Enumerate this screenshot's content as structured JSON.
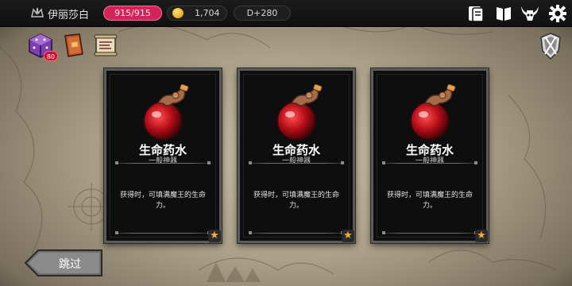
{
  "header": {
    "player_name": "伊丽莎白",
    "hp": "915/915",
    "gold": "1,704",
    "day": "D+280",
    "icons": [
      "crown-icon",
      "coin-icon",
      "quest-card-icon",
      "codex-book-icon",
      "demon-lord-icon",
      "settings-gear-icon"
    ]
  },
  "left_items": {
    "icons": [
      "cube-icon",
      "spellbook-icon",
      "scroll-map-icon"
    ],
    "cube_badge": "80"
  },
  "cards": [
    {
      "name": "生命药水",
      "grade": "一般神器",
      "description": "获得时，可填满魔王的生命力。",
      "icon": "red-potion-icon"
    },
    {
      "name": "生命药水",
      "grade": "一般神器",
      "description": "获得时，可填满魔王的生命力。",
      "icon": "red-potion-icon"
    },
    {
      "name": "生命药水",
      "grade": "一般神器",
      "description": "获得时，可填满魔王的生命力。",
      "icon": "red-potion-icon"
    }
  ],
  "skip_button": {
    "label": "跳过"
  },
  "colors": {
    "hp_pill": "#d2245a",
    "star": "#f0b040",
    "card_border": "#5b5b5b"
  }
}
